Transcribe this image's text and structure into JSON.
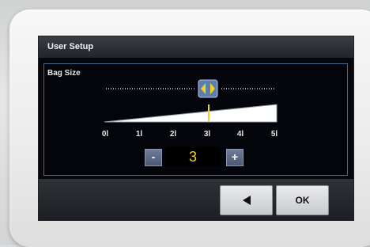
{
  "header": {
    "title": "User Setup"
  },
  "bag_size": {
    "label": "Bag Size",
    "ticks": [
      "0l",
      "1l",
      "2l",
      "3l",
      "4l",
      "5l"
    ],
    "value_index": 3
  },
  "stepper": {
    "minus_label": "-",
    "plus_label": "+",
    "value": "3"
  },
  "footer": {
    "ok_label": "OK",
    "back_icon": "left-arrow-icon"
  },
  "colors": {
    "accent_yellow": "#f2d21a",
    "panel_border": "#4a6a8a"
  }
}
